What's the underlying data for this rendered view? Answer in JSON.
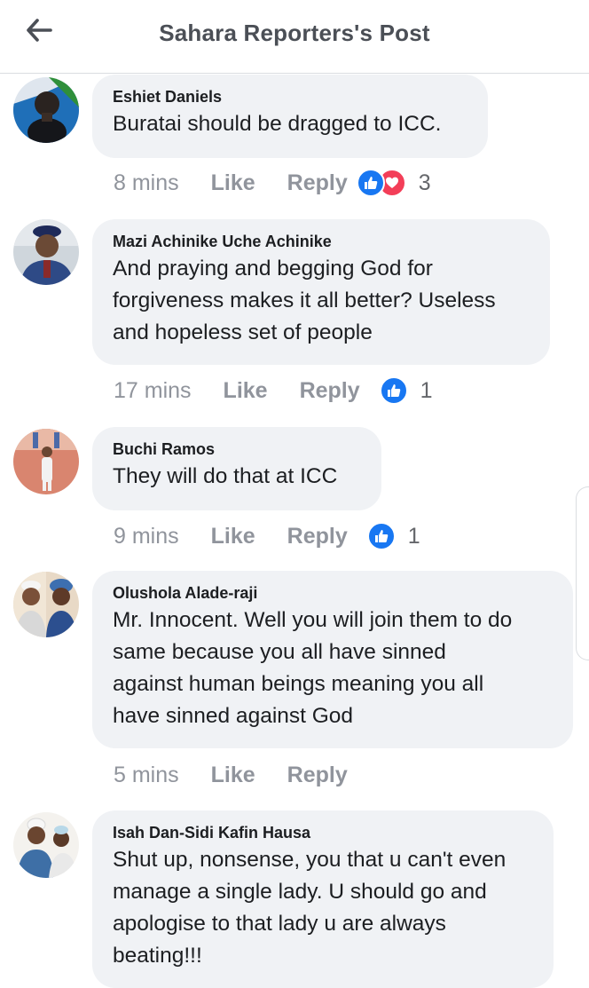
{
  "header": {
    "title": "Sahara Reporters's Post",
    "back_icon": "arrow-left-icon"
  },
  "colors": {
    "like_blue": "#1877f2",
    "love_red": "#f33e58",
    "bubble_bg": "#f0f2f5",
    "meta_gray": "#90949c"
  },
  "comments": [
    {
      "author": "Eshiet Daniels",
      "lines": [
        "Buratai should be dragged to ICC."
      ],
      "time": "8 mins",
      "like": "Like",
      "reply": "Reply",
      "reactions": [
        "like",
        "love"
      ],
      "reaction_count": "3"
    },
    {
      "author": "Mazi Achinike Uche Achinike",
      "lines": [
        "And praying and begging God for",
        "forgiveness makes it all better? Useless",
        "and hopeless set of people"
      ],
      "time": "17 mins",
      "like": "Like",
      "reply": "Reply",
      "reactions": [
        "like"
      ],
      "reaction_count": "1"
    },
    {
      "author": "Buchi Ramos",
      "lines": [
        "They will do that at ICC"
      ],
      "time": "9 mins",
      "like": "Like",
      "reply": "Reply",
      "reactions": [
        "like"
      ],
      "reaction_count": "1"
    },
    {
      "author": "Olushola Alade-raji",
      "lines": [
        "Mr. Innocent. Well you will join them to do",
        "same because you all have sinned",
        "against human beings meaning you all",
        "have sinned against God"
      ],
      "time": "5 mins",
      "like": "Like",
      "reply": "Reply",
      "reactions": [],
      "reaction_count": ""
    },
    {
      "author": "Isah Dan-Sidi Kafin Hausa",
      "lines": [
        "Shut up, nonsense, you that u can't even",
        "manage a single lady. U should go and",
        "apologise to that lady u are always",
        "beating!!!"
      ],
      "time": "",
      "like": "",
      "reply": "",
      "reactions": [],
      "reaction_count": ""
    }
  ]
}
